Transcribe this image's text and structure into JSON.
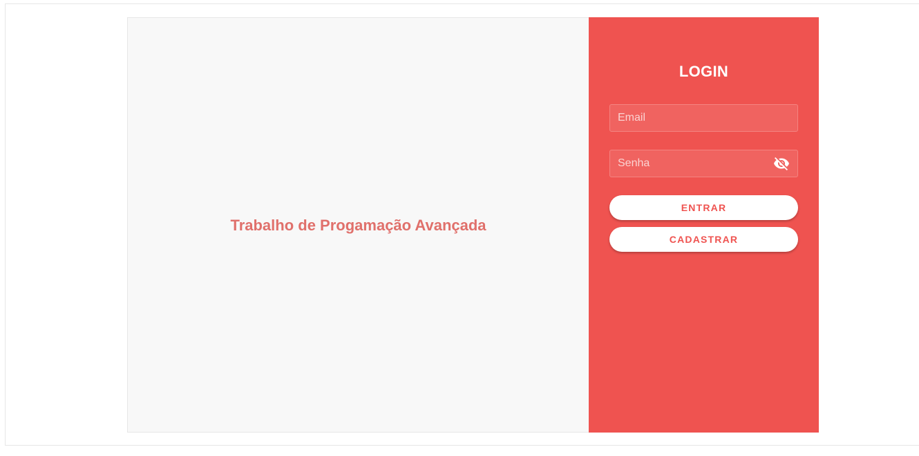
{
  "left": {
    "title": "Trabalho de Progamação Avançada"
  },
  "login": {
    "title": "LOGIN",
    "email": {
      "placeholder": "Email",
      "value": ""
    },
    "password": {
      "placeholder": "Senha",
      "value": "",
      "toggle_icon": "eye-off-icon"
    },
    "submit_label": "ENTRAR",
    "register_label": "CADASTRAR"
  },
  "colors": {
    "accent": "#ef5350",
    "left_title": "#e0706b",
    "left_background": "#f8f8f8"
  }
}
